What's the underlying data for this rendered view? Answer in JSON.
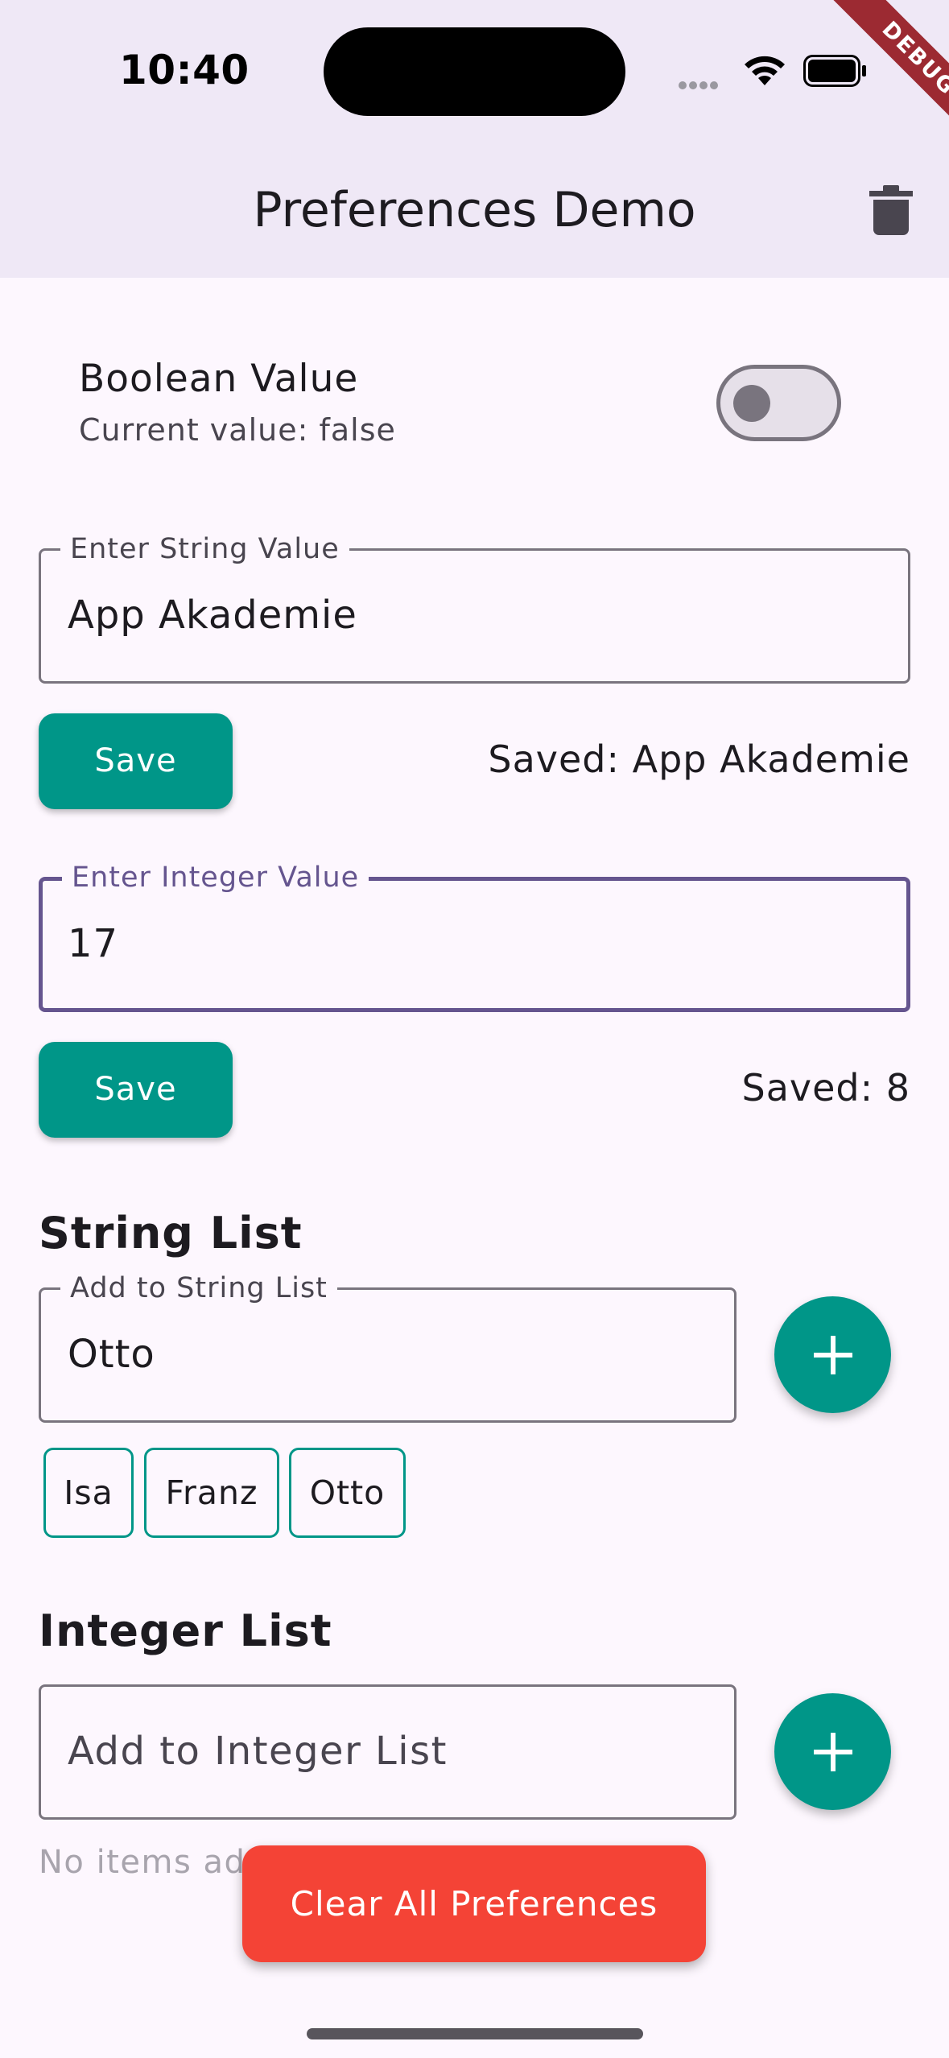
{
  "status_bar": {
    "time": "10:40"
  },
  "debug_banner": "DEBUG",
  "app_bar": {
    "title": "Preferences Demo",
    "delete_icon": "trash-icon"
  },
  "boolean": {
    "title": "Boolean Value",
    "subtitle": "Current value: false",
    "value": false
  },
  "string_field": {
    "label": "Enter String Value",
    "value": "App Akademie",
    "save_label": "Save",
    "saved_text": "Saved: App Akademie"
  },
  "integer_field": {
    "label": "Enter Integer Value",
    "value": "17",
    "save_label": "Save",
    "saved_text": "Saved: 8"
  },
  "string_list": {
    "heading": "String List",
    "input_label": "Add to String List",
    "input_value": "Otto",
    "add_icon": "plus-icon",
    "items": [
      "Isa",
      "Franz",
      "Otto"
    ]
  },
  "integer_list": {
    "heading": "Integer List",
    "input_placeholder": "Add to Integer List",
    "add_icon": "plus-icon",
    "empty_text": "No items added"
  },
  "clear_button": "Clear All Preferences",
  "colors": {
    "accent": "#009688",
    "danger": "#f44336",
    "focus": "#65558f",
    "appbar": "#efe8f6",
    "background": "#fdf7fe"
  }
}
